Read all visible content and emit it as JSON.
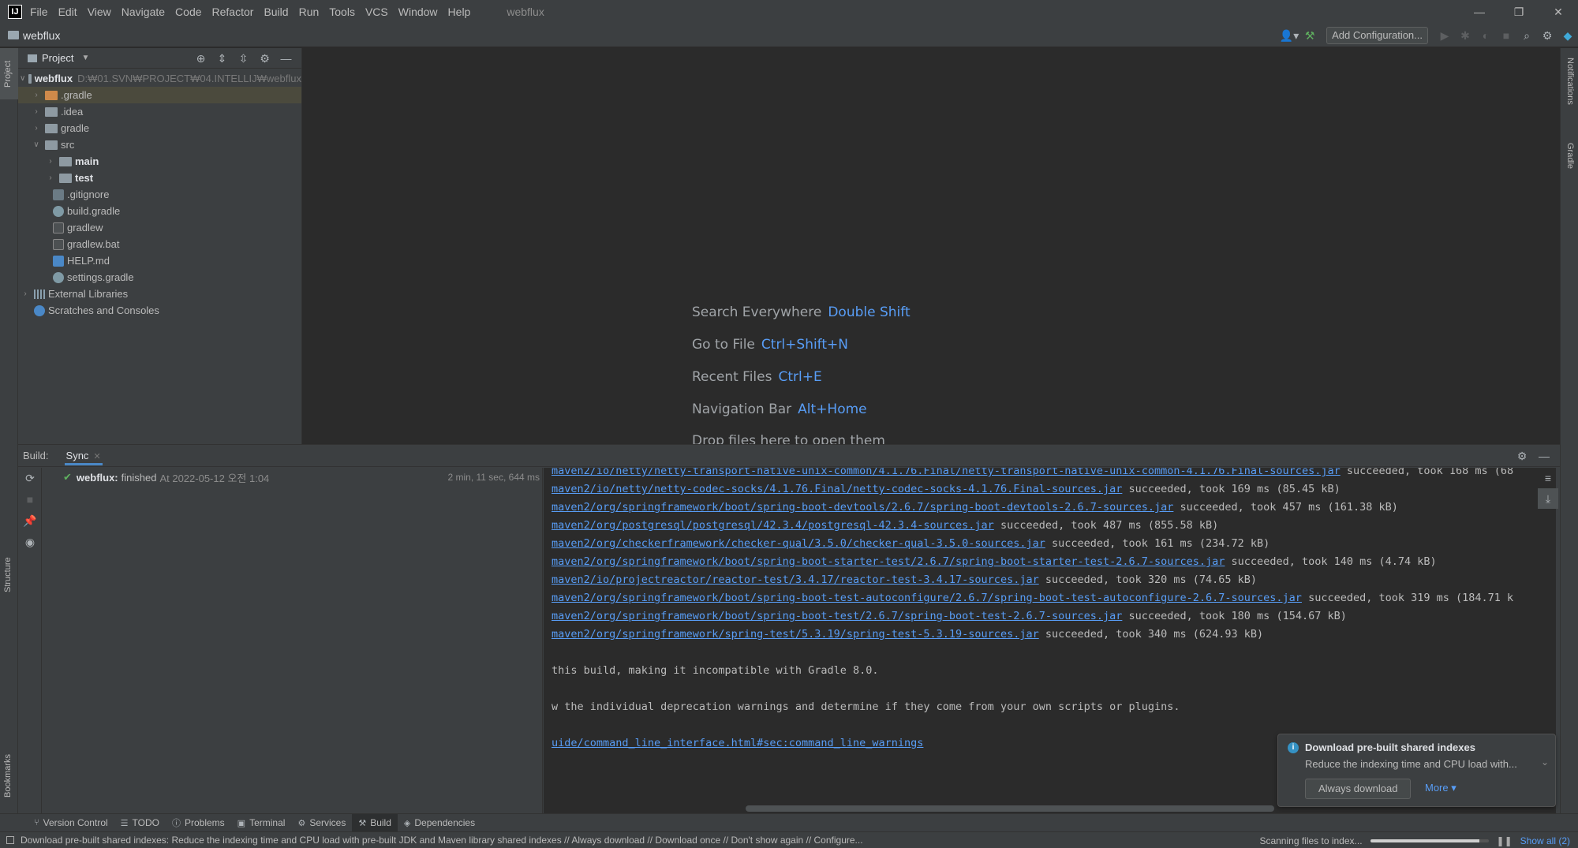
{
  "app": {
    "window_title": "webflux",
    "logo": "IJ"
  },
  "menu": [
    "File",
    "Edit",
    "View",
    "Navigate",
    "Code",
    "Refactor",
    "Build",
    "Run",
    "Tools",
    "VCS",
    "Window",
    "Help"
  ],
  "navbar": {
    "project_name": "webflux",
    "add_config_label": "Add Configuration..."
  },
  "stripes": {
    "left": [
      "Project",
      "Structure",
      "Bookmarks"
    ],
    "right": [
      "Notifications",
      "Gradle"
    ]
  },
  "project_panel": {
    "title": "Project",
    "tree": {
      "root_name": "webflux",
      "root_path": "D:₩01.SVN₩PROJECT₩04.INTELLIJ₩webflux",
      "items": [
        {
          "label": ".gradle"
        },
        {
          "label": ".idea"
        },
        {
          "label": "gradle"
        },
        {
          "label": "src"
        },
        {
          "label": "main"
        },
        {
          "label": "test"
        },
        {
          "label": ".gitignore"
        },
        {
          "label": "build.gradle"
        },
        {
          "label": "gradlew"
        },
        {
          "label": "gradlew.bat"
        },
        {
          "label": "HELP.md"
        },
        {
          "label": "settings.gradle"
        },
        {
          "label": "External Libraries"
        },
        {
          "label": "Scratches and Consoles"
        }
      ]
    }
  },
  "editor_hints": [
    {
      "label": "Search Everywhere",
      "key": "Double Shift"
    },
    {
      "label": "Go to File",
      "key": "Ctrl+Shift+N"
    },
    {
      "label": "Recent Files",
      "key": "Ctrl+E"
    },
    {
      "label": "Navigation Bar",
      "key": "Alt+Home"
    },
    {
      "label": "Drop files here to open them",
      "key": ""
    }
  ],
  "build": {
    "label": "Build:",
    "tab": "Sync",
    "sync": {
      "name": "webflux:",
      "status": "finished",
      "at": "At 2022-05-12 오전 1:04",
      "duration": "2 min, 11 sec, 644 ms"
    },
    "console": [
      {
        "link": "maven2/io/netty/netty-transport-native-unix-common/4.1.76.Final/netty-transport-native-unix-common-4.1.76.Final-sources.jar",
        "text": " succeeded, took 168 ms (68"
      },
      {
        "link": "maven2/io/netty/netty-codec-socks/4.1.76.Final/netty-codec-socks-4.1.76.Final-sources.jar",
        "text": " succeeded, took 169 ms (85.45 kB)"
      },
      {
        "link": "maven2/org/springframework/boot/spring-boot-devtools/2.6.7/spring-boot-devtools-2.6.7-sources.jar",
        "text": " succeeded, took 457 ms (161.38 kB)"
      },
      {
        "link": "maven2/org/postgresql/postgresql/42.3.4/postgresql-42.3.4-sources.jar",
        "text": " succeeded, took 487 ms (855.58 kB)"
      },
      {
        "link": "maven2/org/checkerframework/checker-qual/3.5.0/checker-qual-3.5.0-sources.jar",
        "text": " succeeded, took 161 ms (234.72 kB)"
      },
      {
        "link": "maven2/org/springframework/boot/spring-boot-starter-test/2.6.7/spring-boot-starter-test-2.6.7-sources.jar",
        "text": " succeeded, took 140 ms (4.74 kB)"
      },
      {
        "link": "maven2/io/projectreactor/reactor-test/3.4.17/reactor-test-3.4.17-sources.jar",
        "text": " succeeded, took 320 ms (74.65 kB)"
      },
      {
        "link": "maven2/org/springframework/boot/spring-boot-test-autoconfigure/2.6.7/spring-boot-test-autoconfigure-2.6.7-sources.jar",
        "text": " succeeded, took 319 ms (184.71 k"
      },
      {
        "link": "maven2/org/springframework/boot/spring-boot-test/2.6.7/spring-boot-test-2.6.7-sources.jar",
        "text": " succeeded, took 180 ms (154.67 kB)"
      },
      {
        "link": "maven2/org/springframework/spring-test/5.3.19/spring-test-5.3.19-sources.jar",
        "text": " succeeded, took 340 ms (624.93 kB)"
      },
      {
        "link": "",
        "text": ""
      },
      {
        "link": "",
        "text": " this build, making it incompatible with Gradle 8.0."
      },
      {
        "link": "",
        "text": ""
      },
      {
        "link": "",
        "text": "w the individual deprecation warnings and determine if they come from your own scripts or plugins."
      },
      {
        "link": "",
        "text": ""
      },
      {
        "link": "uide/command_line_interface.html#sec:command_line_warnings",
        "text": ""
      }
    ]
  },
  "notification": {
    "title": "Download pre-built shared indexes",
    "body": "Reduce the indexing time and CPU load with...",
    "button": "Always download",
    "more": "More"
  },
  "bottom_tabs": [
    "Version Control",
    "TODO",
    "Problems",
    "Terminal",
    "Services",
    "Build",
    "Dependencies"
  ],
  "status": {
    "message": "Download pre-built shared indexes: Reduce the indexing time and CPU load with pre-built JDK and Maven library shared indexes // Always download // Download once // Don't show again // Configure...",
    "scanning": "Scanning files to index...",
    "progress": 0.92,
    "show_all": "Show all (2)"
  },
  "colors": {
    "link": "#589df6",
    "selection": "#4b4a3d",
    "success": "#5fb05f"
  }
}
